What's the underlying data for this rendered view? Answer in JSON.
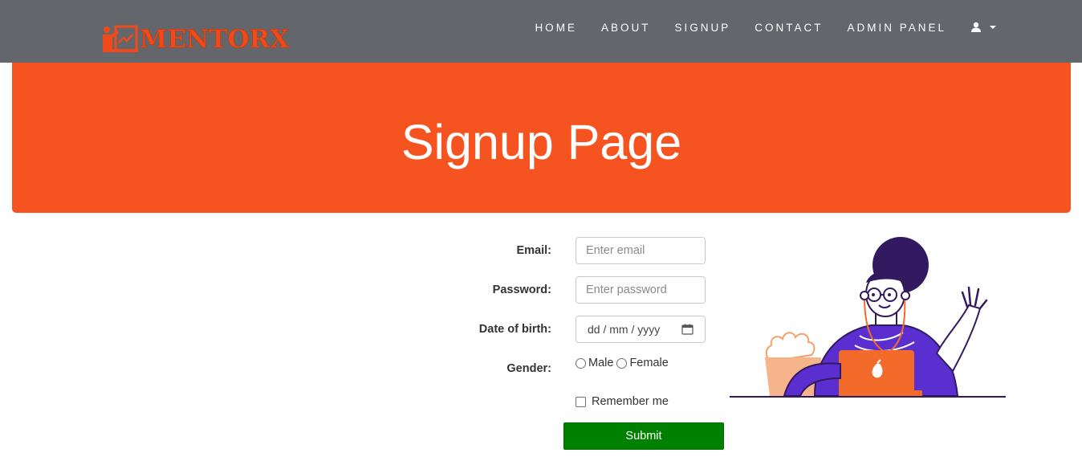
{
  "brand": {
    "name": "MENTORX",
    "color": "#f04a1a"
  },
  "nav": {
    "items": [
      {
        "label": "HOME"
      },
      {
        "label": "ABOUT"
      },
      {
        "label": "SIGNUP"
      },
      {
        "label": "CONTACT"
      },
      {
        "label": "ADMIN PANEL"
      }
    ],
    "user_icon": "user-icon",
    "caret_icon": "caret-down-icon"
  },
  "hero": {
    "title": "Signup Page",
    "color": "#f55420"
  },
  "form": {
    "email_label": "Email:",
    "email_placeholder": "Enter email",
    "password_label": "Password:",
    "password_placeholder": "Enter password",
    "dob_label": "Date of birth:",
    "dob_placeholder": "dd / mm / yyyy",
    "gender_label": "Gender:",
    "gender_options": [
      "Male",
      "Female"
    ],
    "remember_label": "Remember me",
    "submit_label": "Submit",
    "submit_color": "#008000"
  },
  "colors": {
    "navbar": "#63666a",
    "accent": "#f55420",
    "illustration_purple": "#5b2fcf"
  }
}
